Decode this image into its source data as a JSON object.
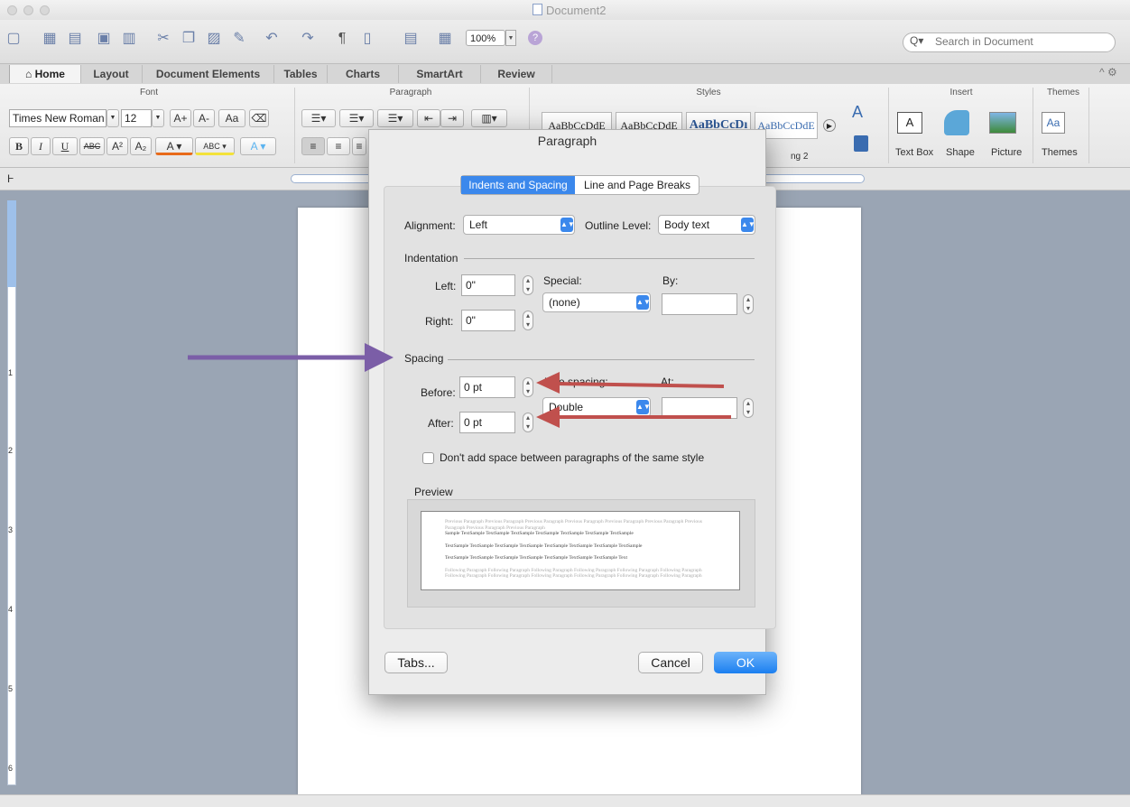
{
  "window": {
    "title": "Document2"
  },
  "toolbar": {
    "zoom": "100%",
    "search_placeholder": "Search in Document"
  },
  "tabs": [
    "Home",
    "Layout",
    "Document Elements",
    "Tables",
    "Charts",
    "SmartArt",
    "Review"
  ],
  "ribbon": {
    "font": {
      "label": "Font",
      "name": "Times New Roman",
      "size": "12"
    },
    "paragraph": {
      "label": "Paragraph"
    },
    "styles": {
      "label": "Styles",
      "samples": [
        "AaBbCcDdE",
        "AaBbCcDdE",
        "AaBbCcDı",
        "AaBbCcDdE",
        "ng 2"
      ]
    },
    "insert": {
      "label": "Insert",
      "items": [
        "Text Box",
        "Shape",
        "Picture"
      ]
    },
    "themes": {
      "label": "Themes",
      "item": "Themes"
    }
  },
  "vruler_numbers": [
    "1",
    "2",
    "3",
    "4",
    "5",
    "6"
  ],
  "dialog": {
    "title": "Paragraph",
    "tabs": [
      "Indents and Spacing",
      "Line and Page Breaks"
    ],
    "alignment_label": "Alignment:",
    "alignment_value": "Left",
    "outline_label": "Outline Level:",
    "outline_value": "Body text",
    "indentation_label": "Indentation",
    "left_label": "Left:",
    "left_value": "0\"",
    "right_label": "Right:",
    "right_value": "0\"",
    "special_label": "Special:",
    "special_value": "(none)",
    "by_label": "By:",
    "spacing_label": "Spacing",
    "before_label": "Before:",
    "before_value": "0 pt",
    "after_label": "After:",
    "after_value": "0 pt",
    "line_spacing_label": "Line spacing:",
    "line_spacing_value": "Double",
    "at_label": "At:",
    "checkbox_label": "Don't add space between paragraphs of the same style",
    "preview_label": "Preview",
    "preview": {
      "prev_para": "Previous Paragraph Previous Paragraph Previous Paragraph Previous Paragraph Previous Paragraph Previous Paragraph Previous Paragraph Previous Paragraph Previous Paragraph",
      "sample1": "Sample TextSample TextSample TextSample TextSample TextSample TextSample TextSample",
      "sample2": "TextSample TextSample TextSample TextSample TextSample TextSample TextSample TextSample",
      "sample3": "TextSample TextSample TextSample TextSample TextSample TextSample TextSample Text",
      "next_para": "Following Paragraph Following Paragraph Following Paragraph Following Paragraph Following Paragraph Following Paragraph Following Paragraph Following Paragraph Following Paragraph Following Paragraph Following Paragraph Following Paragraph"
    },
    "tabs_button": "Tabs...",
    "cancel_button": "Cancel",
    "ok_button": "OK"
  },
  "annotations": {
    "purple_arrow_color": "#7b5ea7",
    "red_arrow_color": "#c0504d"
  }
}
